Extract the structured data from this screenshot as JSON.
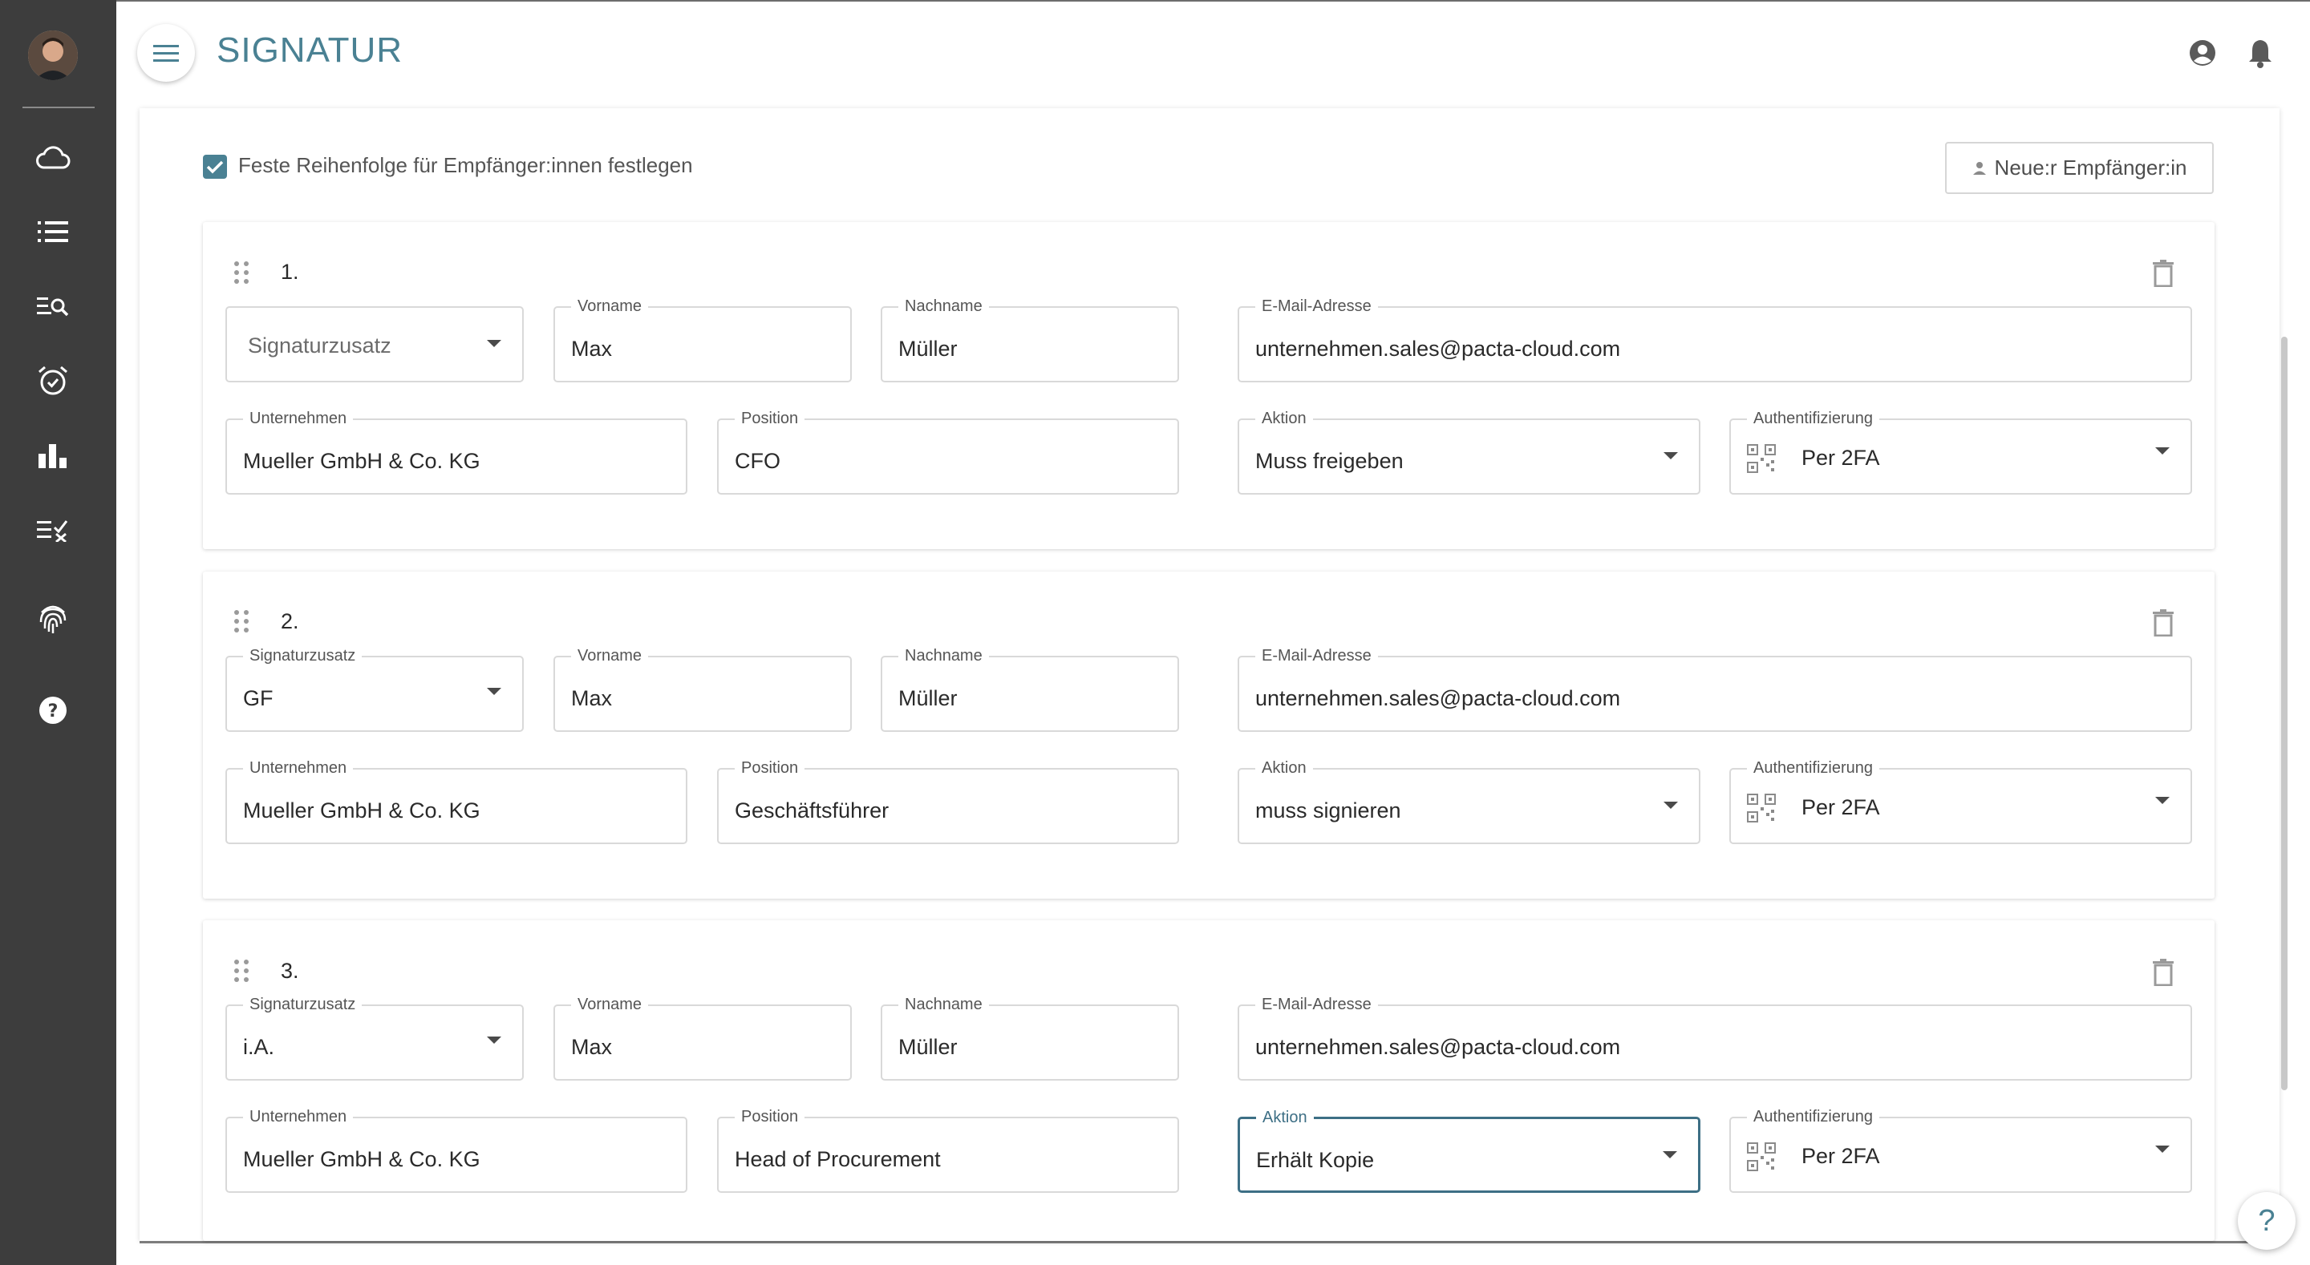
{
  "header": {
    "title": "SIGNATUR"
  },
  "sidebar": {
    "items": [
      {
        "name": "cloud"
      },
      {
        "name": "list"
      },
      {
        "name": "search-list"
      },
      {
        "name": "alarm"
      },
      {
        "name": "chart"
      },
      {
        "name": "checklist"
      },
      {
        "name": "fingerprint"
      },
      {
        "name": "help"
      }
    ]
  },
  "toolbar": {
    "fixed_order_label": "Feste Reihenfolge für Empfänger:innen festlegen",
    "fixed_order_checked": true,
    "new_recipient_label": "Neue:r Empfänger:in"
  },
  "labels": {
    "signaturzusatz": "Signaturzusatz",
    "vorname": "Vorname",
    "nachname": "Nachname",
    "email": "E-Mail-Adresse",
    "unternehmen": "Unternehmen",
    "position": "Position",
    "aktion": "Aktion",
    "auth": "Authentifizierung"
  },
  "recipients": [
    {
      "number": "1.",
      "signaturzusatz": "",
      "signaturzusatz_placeholder": "Signaturzusatz",
      "vorname": "Max",
      "nachname": "Müller",
      "email": "unternehmen.sales@pacta-cloud.com",
      "unternehmen": "Mueller GmbH & Co. KG",
      "position": "CFO",
      "aktion": "Muss freigeben",
      "auth": "Per 2FA"
    },
    {
      "number": "2.",
      "signaturzusatz": "GF",
      "vorname": "Max",
      "nachname": "Müller",
      "email": "unternehmen.sales@pacta-cloud.com",
      "unternehmen": "Mueller GmbH & Co. KG",
      "position": "Geschäftsführer",
      "aktion": "muss signieren",
      "auth": "Per 2FA"
    },
    {
      "number": "3.",
      "signaturzusatz": "i.A.",
      "vorname": "Max",
      "nachname": "Müller",
      "email": "unternehmen.sales@pacta-cloud.com",
      "unternehmen": "Mueller GmbH & Co. KG",
      "position": "Head of Procurement",
      "aktion": "Erhält Kopie",
      "auth": "Per 2FA"
    }
  ],
  "help_fab": "?",
  "colors": {
    "accent": "#4a8193",
    "sidebar": "#3d3d3d",
    "focus": "#3d6f85"
  }
}
